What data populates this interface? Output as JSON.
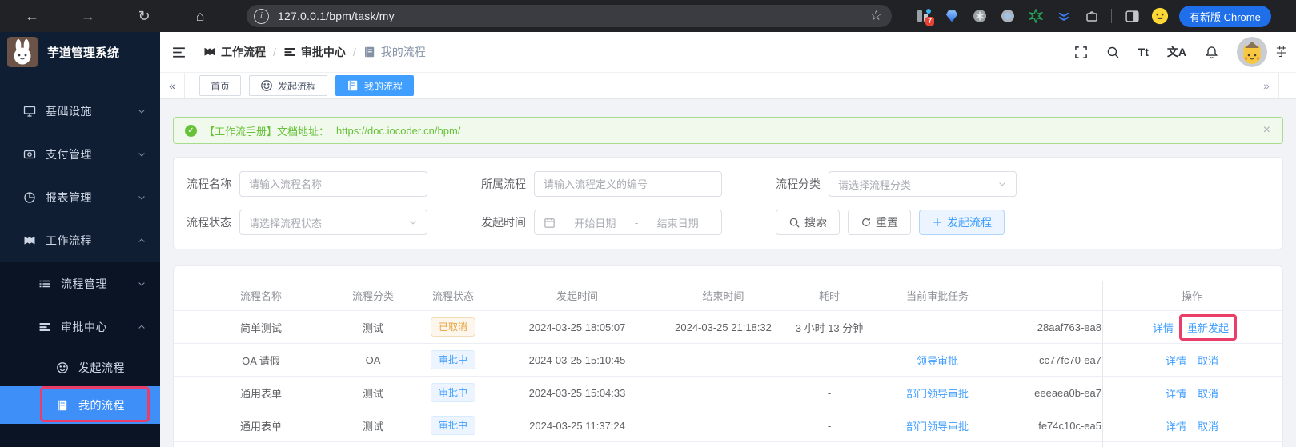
{
  "browser": {
    "url": "127.0.0.1/bpm/task/my",
    "nav_icons": [
      "back-arrow",
      "forward-arrow",
      "reload",
      "home"
    ],
    "url_bar_icons": [
      "site-info",
      "bookmark-star"
    ],
    "extension_icons": [
      "extension-badge-7",
      "blue-gem",
      "gray-asterisk",
      "gray-dot",
      "green-star",
      "blue-layers",
      "puzzle"
    ],
    "tail_icons": [
      "side-panel",
      "profile-emoji"
    ],
    "update_button": "有新版 Chrome"
  },
  "sidebar": {
    "app_title": "芋道管理系统",
    "logo_icon": "rabbit-avatar",
    "items": [
      {
        "label": "基础设施",
        "icon": "monitor",
        "chevron": "down",
        "level": 1
      },
      {
        "label": "支付管理",
        "icon": "payment",
        "chevron": "down",
        "level": 1
      },
      {
        "label": "报表管理",
        "icon": "pie-chart",
        "chevron": "down",
        "level": 1
      },
      {
        "label": "工作流程",
        "icon": "flag",
        "chevron": "up",
        "level": 1
      },
      {
        "label": "流程管理",
        "icon": "list",
        "chevron": "down",
        "level": 2,
        "sub": true
      },
      {
        "label": "审批中心",
        "icon": "rows",
        "chevron": "up",
        "level": 2,
        "sub": true
      },
      {
        "label": "发起流程",
        "icon": "smile",
        "level": 3,
        "sub": true
      },
      {
        "label": "我的流程",
        "icon": "notebook",
        "level": 3,
        "sub": true,
        "active": true,
        "annotated": true
      }
    ]
  },
  "header": {
    "breadcrumb": [
      {
        "label": "工作流程",
        "icon": "flag"
      },
      {
        "label": "审批中心",
        "icon": "rows"
      },
      {
        "label": "我的流程",
        "icon": "notebook"
      }
    ],
    "separator": "/",
    "toolbar_icons": [
      "fullscreen",
      "search",
      "font-size",
      "translate",
      "bell"
    ],
    "avatar_icon": "pikachu-avatar",
    "username_partial": "芋"
  },
  "tabs": {
    "left_arrow": "«",
    "right_arrow": "»",
    "items": [
      {
        "label": "首页"
      },
      {
        "label": "发起流程",
        "icon": "smile"
      },
      {
        "label": "我的流程",
        "icon": "notebook",
        "active": true
      }
    ]
  },
  "banner": {
    "icon": "check-circle",
    "text": "【工作流手册】文档地址：",
    "link": "https://doc.iocoder.cn/bpm/",
    "close_icon": "close"
  },
  "filters": {
    "name_label": "流程名称",
    "name_placeholder": "请输入流程名称",
    "definition_label": "所属流程",
    "definition_placeholder": "请输入流程定义的编号",
    "category_label": "流程分类",
    "category_placeholder": "请选择流程分类",
    "status_label": "流程状态",
    "status_placeholder": "请选择流程状态",
    "time_label": "发起时间",
    "time_start_placeholder": "开始日期",
    "time_separator": "-",
    "time_end_placeholder": "结束日期",
    "search_button": "搜索",
    "reset_button": "重置",
    "create_button": "发起流程"
  },
  "table": {
    "columns": [
      "流程名称",
      "流程分类",
      "流程状态",
      "发起时间",
      "结束时间",
      "耗时",
      "当前审批任务",
      "",
      "操作"
    ],
    "rows": [
      {
        "name": "简单测试",
        "category": "测试",
        "status": {
          "text": "已取消",
          "type": "warning"
        },
        "start_time": "2024-03-25 18:05:07",
        "end_time": "2024-03-25 21:18:32",
        "duration": "3 小时 13 分钟",
        "current_task": "",
        "process_id": "28aaf763-ea8",
        "actions": [
          {
            "label": "详情"
          },
          {
            "label": "重新发起",
            "annotated": true
          }
        ]
      },
      {
        "name": "OA 请假",
        "category": "OA",
        "status": {
          "text": "审批中",
          "type": "primary"
        },
        "start_time": "2024-03-25 15:10:45",
        "end_time": "",
        "duration": "-",
        "current_task": "领导审批",
        "process_id": "cc77fc70-ea7",
        "actions": [
          {
            "label": "详情"
          },
          {
            "label": "取消"
          }
        ]
      },
      {
        "name": "通用表单",
        "category": "测试",
        "status": {
          "text": "审批中",
          "type": "primary"
        },
        "start_time": "2024-03-25 15:04:33",
        "end_time": "",
        "duration": "-",
        "current_task": "部门领导审批",
        "process_id": "eeeaea0b-ea7",
        "actions": [
          {
            "label": "详情"
          },
          {
            "label": "取消"
          }
        ]
      },
      {
        "name": "通用表单",
        "category": "测试",
        "status": {
          "text": "审批中",
          "type": "primary"
        },
        "start_time": "2024-03-25 11:37:24",
        "end_time": "",
        "duration": "-",
        "current_task": "部门领导审批",
        "process_id": "fe74c10c-ea5",
        "actions": [
          {
            "label": "详情"
          },
          {
            "label": "取消"
          }
        ]
      }
    ]
  },
  "colors": {
    "accent": "#409eff",
    "success": "#67c23a",
    "warning": "#e6a23c",
    "sidebar_bg": "#0f1e33",
    "annotation": "#ea3d68"
  }
}
